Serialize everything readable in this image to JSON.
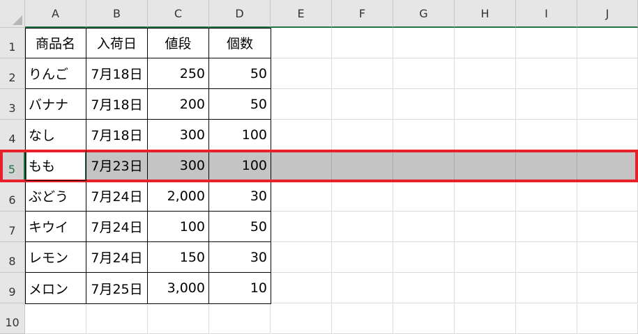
{
  "columns": [
    "A",
    "B",
    "C",
    "D",
    "E",
    "F",
    "G",
    "H",
    "I",
    "J"
  ],
  "rows": [
    "1",
    "2",
    "3",
    "4",
    "5",
    "6",
    "7",
    "8",
    "9",
    "10"
  ],
  "selected_row": "5",
  "header_row": {
    "a": "商品名",
    "b": "入荷日",
    "c": "値段",
    "d": "個数"
  },
  "data_rows": [
    {
      "a": "りんご",
      "b": "7月18日",
      "c": "250",
      "d": "50"
    },
    {
      "a": "バナナ",
      "b": "7月18日",
      "c": "200",
      "d": "50"
    },
    {
      "a": "なし",
      "b": "7月18日",
      "c": "300",
      "d": "100"
    },
    {
      "a": "もも",
      "b": "7月23日",
      "c": "300",
      "d": "100"
    },
    {
      "a": "ぶどう",
      "b": "7月24日",
      "c": "2,000",
      "d": "30"
    },
    {
      "a": "キウイ",
      "b": "7月24日",
      "c": "100",
      "d": "50"
    },
    {
      "a": "レモン",
      "b": "7月24日",
      "c": "150",
      "d": "30"
    },
    {
      "a": "メロン",
      "b": "7月25日",
      "c": "3,000",
      "d": "10"
    }
  ],
  "colors": {
    "accent": "#217346",
    "highlight": "#c4c4c4",
    "selection_outline": "#e8202a"
  }
}
